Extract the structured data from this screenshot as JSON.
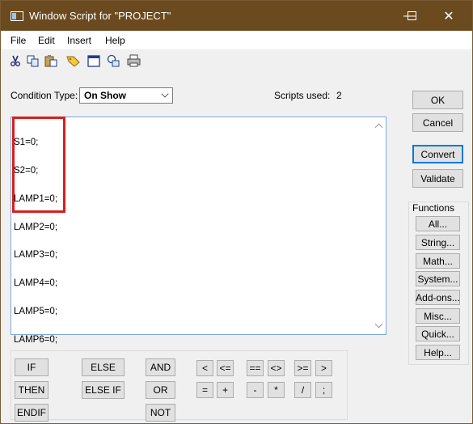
{
  "window": {
    "title": "Window Script for \"PROJECT\"",
    "minimize": "—",
    "maximize": "☐",
    "close": "✕"
  },
  "menu": {
    "file": "File",
    "edit": "Edit",
    "insert": "Insert",
    "help": "Help"
  },
  "toolbar": {
    "icons": [
      "scissors-icon",
      "copy-icon",
      "paste-icon",
      "tag-icon",
      "window-icon",
      "graphic-icon",
      "print-icon"
    ]
  },
  "condition": {
    "label": "Condition Type:",
    "value": "On Show"
  },
  "scripts_used": {
    "label": "Scripts used:",
    "value": "2"
  },
  "code_lines": [
    "S1=0;",
    "S2=0;",
    "LAMP1=0;",
    "LAMP2=0;",
    "LAMP3=0;",
    "LAMP4=0;",
    "LAMP5=0;",
    "LAMP6=0;"
  ],
  "buttons": {
    "ok": "OK",
    "cancel": "Cancel",
    "convert": "Convert",
    "validate": "Validate"
  },
  "functions": {
    "title": "Functions",
    "items": [
      "All...",
      "String...",
      "Math...",
      "System...",
      "Add-ons...",
      "Misc...",
      "Quick...",
      "Help..."
    ]
  },
  "keywords": {
    "if": "IF",
    "then": "THEN",
    "endif": "ENDIF",
    "else": "ELSE",
    "else_if": "ELSE IF",
    "and": "AND",
    "or": "OR",
    "not": "NOT"
  },
  "operators": {
    "lt": "<",
    "le": "<=",
    "eq": "==",
    "ne": "<>",
    "ge": ">=",
    "gt": ">",
    "assign": "=",
    "plus": "+",
    "minus": "-",
    "multiply": "*",
    "divide": "/",
    "semicolon": ";"
  },
  "colors": {
    "titlebar": "#6b4a1f",
    "highlight": "#d42020",
    "focus": "#0078d7"
  }
}
